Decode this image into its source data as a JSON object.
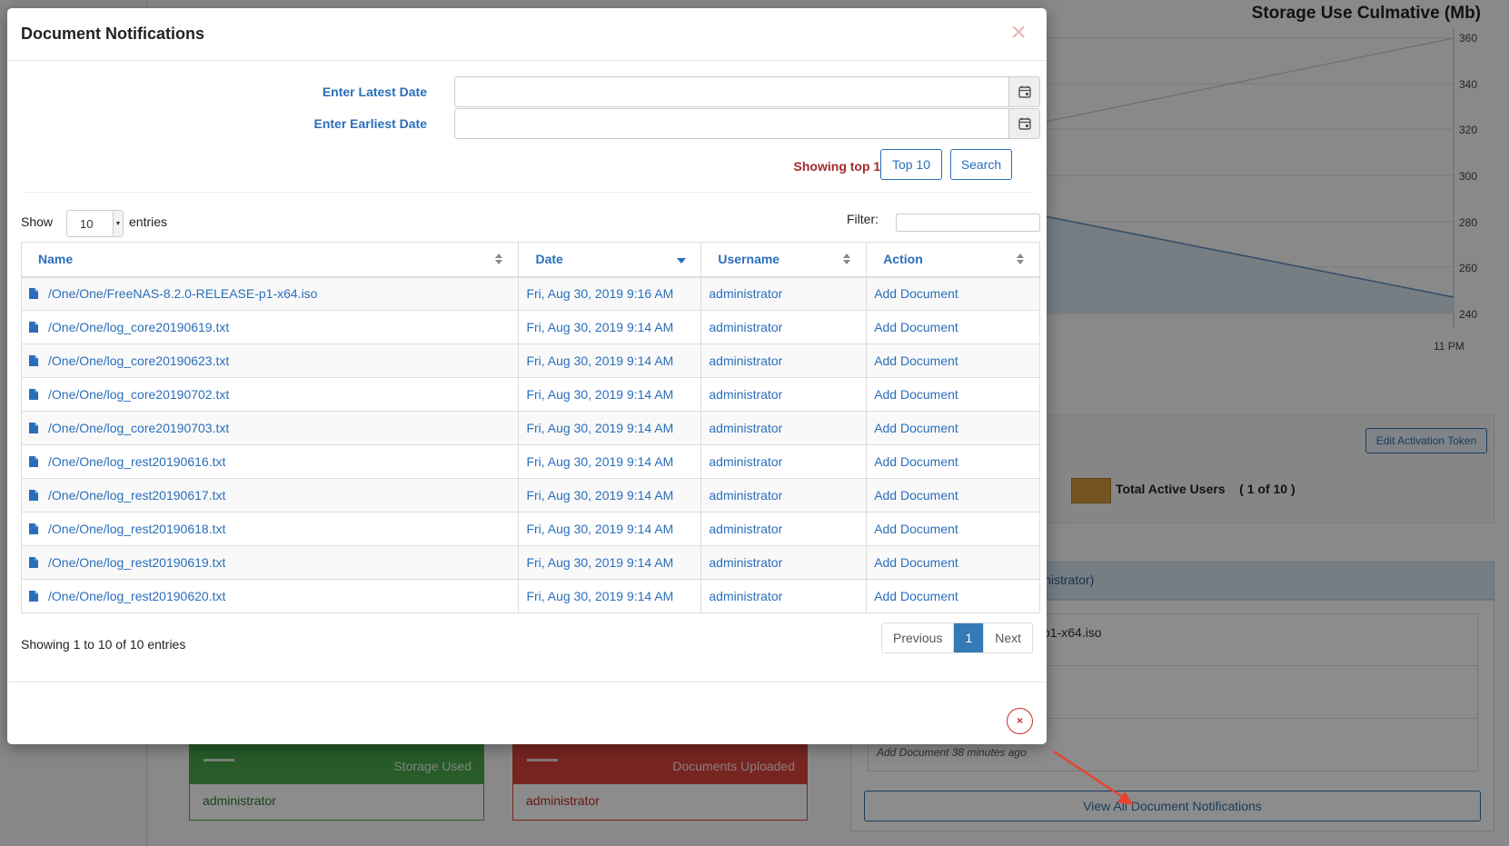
{
  "background": {
    "chart_title": "Storage Use Culmative (Mb)",
    "chart_y_ticks": [
      "360",
      "340",
      "320",
      "300",
      "280",
      "260",
      "240"
    ],
    "chart_x_tick": "11 PM",
    "edit_token_label": "Edit Activation Token",
    "legend_label": "Total Active Users    ( 1 of 10 )",
    "notifications_header_fragment": "inistrator)",
    "notification_item_fragment": "p1-x64.iso",
    "notification_time": "Add Document 38 minutes ago",
    "view_all_label": "View All Document Notifications",
    "storage_card": {
      "label": "Storage Used",
      "user": "administrator",
      "color": "#48a74a"
    },
    "docs_card": {
      "label": "Documents Uploaded",
      "user": "administrator",
      "color": "#d9443d"
    }
  },
  "modal": {
    "title": "Document Notifications",
    "latest_date_label": "Enter Latest Date",
    "earliest_date_label": "Enter Earliest Date",
    "latest_date_value": "",
    "earliest_date_value": "",
    "showing_top": "Showing top 10",
    "top10_label": "Top 10",
    "search_label": "Search",
    "show_label": "Show",
    "entries_value": "10",
    "entries_label": "entries",
    "filter_label": "Filter:",
    "filter_value": "",
    "columns": [
      "Name",
      "Date",
      "Username",
      "Action"
    ],
    "rows": [
      {
        "name": "/One/One/FreeNAS-8.2.0-RELEASE-p1-x64.iso",
        "date": "Fri, Aug 30, 2019 9:16 AM",
        "user": "administrator",
        "action": "Add Document"
      },
      {
        "name": "/One/One/log_core20190619.txt",
        "date": "Fri, Aug 30, 2019 9:14 AM",
        "user": "administrator",
        "action": "Add Document"
      },
      {
        "name": "/One/One/log_core20190623.txt",
        "date": "Fri, Aug 30, 2019 9:14 AM",
        "user": "administrator",
        "action": "Add Document"
      },
      {
        "name": "/One/One/log_core20190702.txt",
        "date": "Fri, Aug 30, 2019 9:14 AM",
        "user": "administrator",
        "action": "Add Document"
      },
      {
        "name": "/One/One/log_core20190703.txt",
        "date": "Fri, Aug 30, 2019 9:14 AM",
        "user": "administrator",
        "action": "Add Document"
      },
      {
        "name": "/One/One/log_rest20190616.txt",
        "date": "Fri, Aug 30, 2019 9:14 AM",
        "user": "administrator",
        "action": "Add Document"
      },
      {
        "name": "/One/One/log_rest20190617.txt",
        "date": "Fri, Aug 30, 2019 9:14 AM",
        "user": "administrator",
        "action": "Add Document"
      },
      {
        "name": "/One/One/log_rest20190618.txt",
        "date": "Fri, Aug 30, 2019 9:14 AM",
        "user": "administrator",
        "action": "Add Document"
      },
      {
        "name": "/One/One/log_rest20190619.txt",
        "date": "Fri, Aug 30, 2019 9:14 AM",
        "user": "administrator",
        "action": "Add Document"
      },
      {
        "name": "/One/One/log_rest20190620.txt",
        "date": "Fri, Aug 30, 2019 9:14 AM",
        "user": "administrator",
        "action": "Add Document"
      }
    ],
    "summary": "Showing 1 to 10 of 10 entries",
    "pager": {
      "previous": "Previous",
      "page": "1",
      "next": "Next"
    },
    "close_x": "×",
    "footer_close": "×"
  },
  "colors": {
    "link": "#2a6ebb",
    "accent_red": "#a52a2a",
    "pager_active": "#337ab7",
    "arrow": "#e8432f"
  }
}
